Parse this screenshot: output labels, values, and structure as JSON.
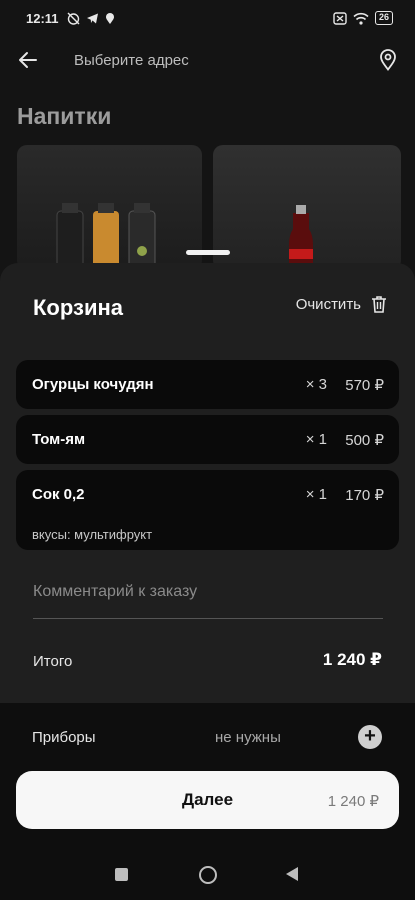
{
  "status_bar": {
    "time": "12:11",
    "battery": "26"
  },
  "header": {
    "address_placeholder": "Выберите адрес"
  },
  "category": {
    "title": "Напитки"
  },
  "cart": {
    "title": "Корзина",
    "clear_label": "Очистить",
    "items": [
      {
        "name": "Огурцы кочудян",
        "qty": "× 3",
        "price": "570 ₽",
        "note": ""
      },
      {
        "name": "Том-ям",
        "qty": "× 1",
        "price": "500 ₽",
        "note": ""
      },
      {
        "name": "Сок 0,2",
        "qty": "× 1",
        "price": "170 ₽",
        "note": "вкусы: мультифрукт"
      }
    ],
    "comment_placeholder": "Комментарий к заказу",
    "total_label": "Итого",
    "total_value": "1 240 ₽"
  },
  "cutlery": {
    "label": "Приборы",
    "value": "не нужны"
  },
  "next_button": {
    "label": "Далее",
    "sum": "1 240 ₽"
  },
  "colors": {
    "background": "#141414",
    "sheet": "#1f1f1f",
    "item_card": "#0a0a0a",
    "primary_button": "#f7f7f7"
  }
}
